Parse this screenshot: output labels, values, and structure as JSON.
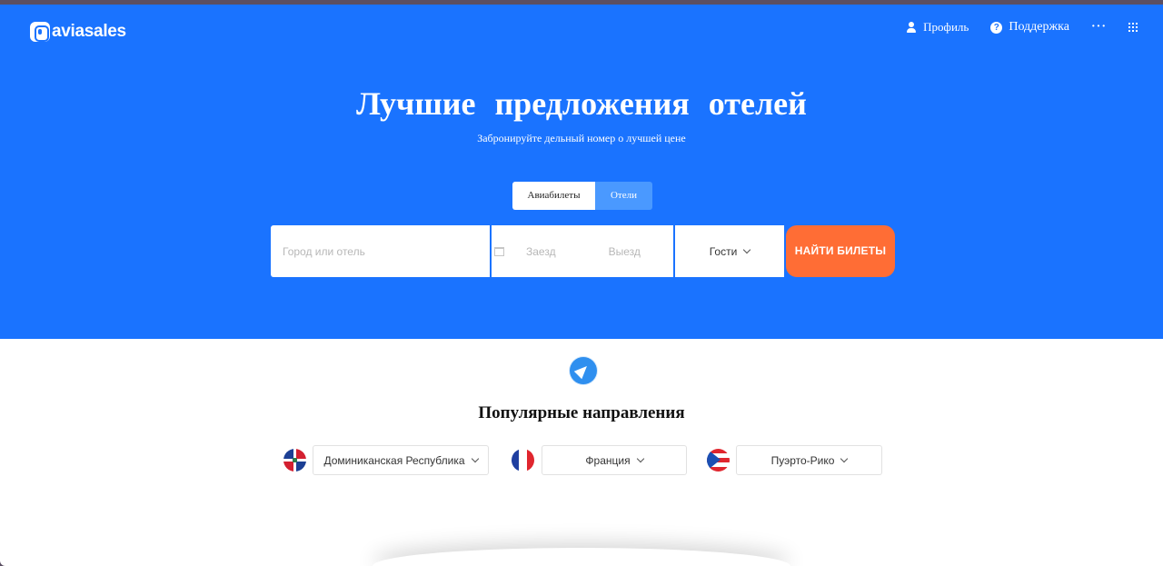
{
  "header": {
    "logo_text": "aviasales",
    "nav": {
      "profile": "Профиль",
      "support": "Поддержка",
      "more_icon": "more-dots-icon",
      "apps_icon": "grid-icon"
    }
  },
  "hero": {
    "title": "Лучшие предложения отелей",
    "subtitle": "Забронируйте дельный номер о лучшей цене",
    "tabs": [
      {
        "label": "Авиабилеты",
        "active": false
      },
      {
        "label": "Отели",
        "active": true
      }
    ]
  },
  "search": {
    "city_placeholder": "Город или отель",
    "checkin_label": "Заезд",
    "checkout_label": "Выезд",
    "guests_label": "Гости",
    "submit_label": "НАЙТИ БИЛЕТЫ"
  },
  "popular": {
    "title": "Популярные направления",
    "destinations": [
      {
        "label": "Доминиканская Республика",
        "flag": "flag-dominican-republic-icon"
      },
      {
        "label": "Франция",
        "flag": "flag-france-icon"
      },
      {
        "label": "Пуэрто-Рико",
        "flag": "flag-puerto-rico-icon"
      }
    ]
  },
  "colors": {
    "hero_blue": "#1a73ff",
    "active_tab": "#4a99ff",
    "search_button": "#ff6d35",
    "window_frame": "#5b4f63"
  }
}
